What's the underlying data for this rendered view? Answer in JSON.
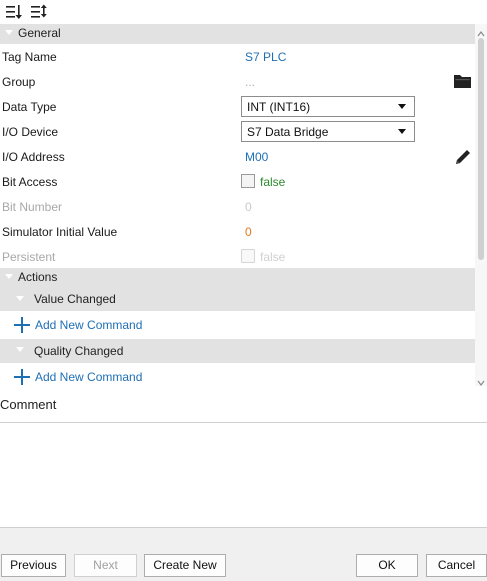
{
  "toolbar": {
    "icons": [
      "sort-categorized-icon",
      "sort-alphabetical-icon"
    ]
  },
  "general": {
    "label": "General",
    "rows": {
      "tag_name": {
        "name": "Tag Name",
        "value": "S7 PLC"
      },
      "group": {
        "name": "Group",
        "value": "..."
      },
      "data_type": {
        "name": "Data Type",
        "value": "INT (INT16)"
      },
      "io_device": {
        "name": "I/O Device",
        "value": "S7 Data Bridge"
      },
      "io_address": {
        "name": "I/O Address",
        "value": "M00"
      },
      "bit_access": {
        "name": "Bit Access",
        "value": "false"
      },
      "bit_number": {
        "name": "Bit Number",
        "value": "0"
      },
      "sim_initial": {
        "name": "Simulator Initial Value",
        "value": "0"
      },
      "persistent": {
        "name": "Persistent",
        "value": "false"
      }
    }
  },
  "actions": {
    "label": "Actions",
    "value_changed": {
      "label": "Value Changed",
      "add_label": "Add New Command"
    },
    "quality_changed": {
      "label": "Quality Changed",
      "add_label": "Add New Command"
    }
  },
  "comment": {
    "label": "Comment",
    "value": ""
  },
  "buttons": {
    "previous": "Previous",
    "next": "Next",
    "create_new": "Create New",
    "ok": "OK",
    "cancel": "Cancel"
  },
  "colors": {
    "link_blue": "#1f6fb5",
    "false_green": "#2e8b2e",
    "number_orange": "#e07a1f",
    "category_grey": "#e2e2e2"
  }
}
